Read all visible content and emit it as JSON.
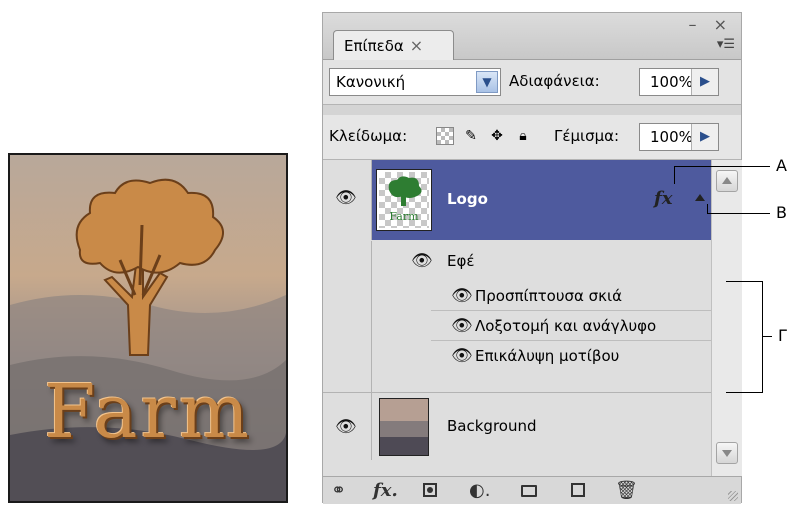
{
  "artwork": {
    "text": "Farm"
  },
  "panel": {
    "tab_label": "Επίπεδα",
    "tab_close": "×",
    "window_buttons": "– ×",
    "panel_menu_icon": "panel-menu-icon",
    "blend_mode": "Κανονική",
    "opacity_label": "Αδιαφάνεια:",
    "opacity_value": "100%",
    "lock_label": "Κλείδωμα:",
    "fill_label": "Γέμισμα:",
    "fill_value": "100%"
  },
  "layers": {
    "logo": {
      "name": "Logo",
      "thumb_text": "Farm"
    },
    "effects": {
      "label": "Εφέ",
      "items": [
        "Προσπίπτουσα σκιά",
        "Λοξοτομή και ανάγλυφο",
        "Επικάλυψη μοτίβου"
      ]
    },
    "background": {
      "name": "Background"
    }
  },
  "callouts": {
    "a": "A",
    "b": "B",
    "c": "Γ"
  },
  "icons": {
    "eye": "eye-icon",
    "fx": "fx-icon",
    "link": "link-layers-icon",
    "mask": "add-mask-icon",
    "adjust": "adjustment-layer-icon",
    "folder": "new-group-icon",
    "new_layer": "new-layer-icon",
    "trash": "trash-icon"
  },
  "colors": {
    "selected_layer": "#4e5a9e",
    "artwork_text": "#c98a48"
  }
}
